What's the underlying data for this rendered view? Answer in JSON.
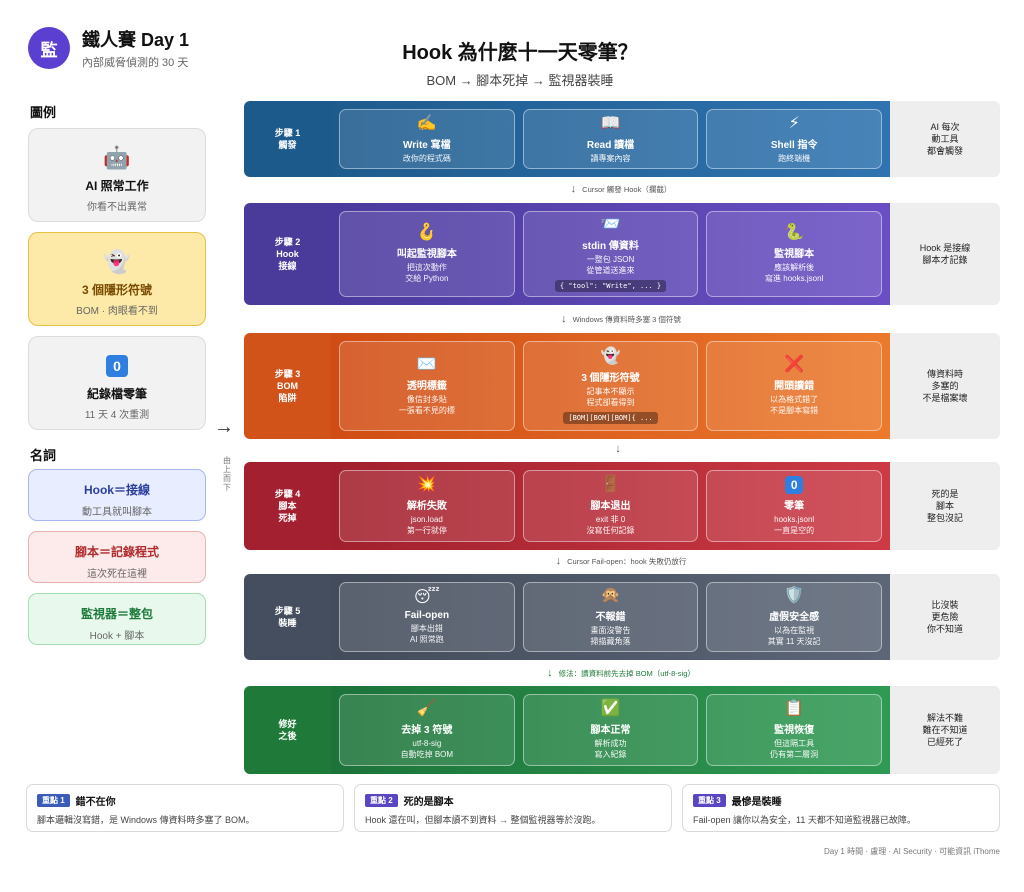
{
  "header": {
    "logo": "監",
    "title": "鐵人賽 Day 1",
    "subtitle": "內部威脅偵測的 30 天"
  },
  "main": {
    "title": "Hook 為什麼十一天零筆？",
    "subtitle": "BOM → 腳本死掉 → 監視器裝睡"
  },
  "legend": {
    "heading": "圖例",
    "items": [
      {
        "icon": "🤖",
        "title": "AI 照常工作",
        "sub": "你看不出異常",
        "bg": "#f2f2f2",
        "border": "#dcdcdc",
        "tc": "#111"
      },
      {
        "icon": "👻",
        "title": "3 個隱形符號",
        "sub": "BOM · 肉眼看不到",
        "bg": "#fde9a8",
        "border": "#e6bf45",
        "tc": "#7a4a00"
      },
      {
        "icon": "0",
        "title": "紀錄檔零筆",
        "sub": "11 天 4 次重測",
        "bg": "#f2f2f2",
        "border": "#dcdcdc",
        "tc": "#111"
      }
    ]
  },
  "terms": {
    "heading": "名詞",
    "items": [
      {
        "title": "Hook＝接線",
        "sub": "動工具就叫腳本",
        "bg": "#e8edff",
        "border": "#a9b7ee",
        "tc": "#2a3f9e"
      },
      {
        "title": "腳本＝記錄程式",
        "sub": "這次死在這裡",
        "bg": "#fdeaea",
        "border": "#ebb0b0",
        "tc": "#b02a2a"
      },
      {
        "title": "監視器＝整包",
        "sub": "Hook + 腳本",
        "bg": "#e8f8ec",
        "border": "#a5dcb3",
        "tc": "#1d7a3a"
      }
    ]
  },
  "flow_arrow": "→",
  "vertical_note": "由上而下",
  "rows": [
    {
      "step": "步驟 1\n觸發",
      "color": "#1d5a8c",
      "grad": "linear-gradient(90deg,#1e5b8d,#2f73b0)",
      "side": "AI 每次\n動工具\n都會觸發",
      "cards": [
        {
          "icon": "✍️",
          "title": "Write 寫檔",
          "sub": "改你的程式碼"
        },
        {
          "icon": "📖",
          "title": "Read 讀檔",
          "sub": "讀專案內容"
        },
        {
          "icon": "⚡",
          "title": "Shell 指令",
          "sub": "跑終端機"
        }
      ]
    },
    {
      "step": "步驟 2\nHook\n接線",
      "color": "#4a3a9a",
      "grad": "linear-gradient(90deg,#4b3a9d,#6a4fc4)",
      "side": "Hook 是接線\n腳本才記錄",
      "cards": [
        {
          "icon": "🪝",
          "title": "叫起監視腳本",
          "sub": "把這次動作\n交給 Python"
        },
        {
          "icon": "📨",
          "title": "stdin 傳資料",
          "sub": "一整包 JSON\n從管道送進來",
          "code": "{ \"tool\": \"Write\", ... }"
        },
        {
          "icon": "🐍",
          "title": "監視腳本",
          "sub": "應該解析後\n寫進 hooks.jsonl"
        }
      ]
    },
    {
      "step": "步驟 3\nBOM\n陷阱",
      "color": "#d2531a",
      "grad": "linear-gradient(90deg,#d04c14,#ec7a2c)",
      "side": "傳資料時\n多塞的\n不是檔案壞",
      "cards": [
        {
          "icon": "✉️",
          "title": "透明標籤",
          "sub": "像信封多貼\n一張看不見的標"
        },
        {
          "icon": "👻",
          "title": "3 個隱形符號",
          "sub": "記事本不顯示\n程式卻看得到",
          "code": "[BOM][BOM][BOM]{ ..."
        },
        {
          "icon": "❌",
          "title": "開頭讀錯",
          "sub": "以為格式錯了\n不是腳本寫錯"
        }
      ]
    },
    {
      "step": "步驟 4\n腳本\n死掉",
      "color": "#a32030",
      "grad": "linear-gradient(90deg,#a1202d,#cc3a45)",
      "side": "死的是\n腳本\n整包沒記",
      "cards": [
        {
          "icon": "💥",
          "title": "解析失敗",
          "sub": "json.load\n第一行就停"
        },
        {
          "icon": "🚪",
          "title": "腳本退出",
          "sub": "exit 非 0\n沒寫任何記錄"
        },
        {
          "icon": "0",
          "title": "零筆",
          "sub": "hooks.jsonl\n一直是空的"
        }
      ]
    },
    {
      "step": "步驟 5\n裝睡",
      "color": "#444e5e",
      "grad": "linear-gradient(90deg,#434c5b,#5c6677)",
      "side": "比沒裝\n更危險\n你不知道",
      "cards": [
        {
          "icon": "😴",
          "title": "Fail-open",
          "sub": "腳本出錯\nAI 照常跑"
        },
        {
          "icon": "🙊",
          "title": "不報錯",
          "sub": "畫面沒警告\n掃描藏角落"
        },
        {
          "icon": "🛡️",
          "title": "虛假安全感",
          "sub": "以為在監視\n其實 11 天沒記"
        }
      ]
    },
    {
      "step": "修好\n之後",
      "color": "#1f7a3a",
      "grad": "linear-gradient(90deg,#1d733a,#2f9a53)",
      "side": "解法不難\n難在不知道\n已經死了",
      "cards": [
        {
          "icon": "🧹",
          "title": "去掉 3 符號",
          "sub": "utf-8-sig\n自動吃掉 BOM"
        },
        {
          "icon": "✅",
          "title": "腳本正常",
          "sub": "解析成功\n寫入紀錄"
        },
        {
          "icon": "📋",
          "title": "監視恢復",
          "sub": "但這隔工具\n仍有第二層洞"
        }
      ]
    }
  ],
  "connectors": [
    "Cursor 觸發 Hook（攔截）",
    "Windows 傳資料時多塞 3 個符號",
    "",
    "Cursor Fail-open：hook 失敗仍放行",
    "修法：讀資料前先去掉 BOM（utf-8-sig）"
  ],
  "notes": [
    {
      "badge": "重點 1",
      "title": "錯不在你",
      "body": "腳本邏輯沒寫錯，是 Windows 傳資料時多塞了 BOM。"
    },
    {
      "badge": "重點 2",
      "title": "死的是腳本",
      "body": "Hook 還在叫，但腳本讀不到資料 → 整個監視器等於沒跑。"
    },
    {
      "badge": "重點 3",
      "title": "最慘是裝睡",
      "body": "Fail-open 讓你以為安全，11 天都不知道監視器已故障。"
    }
  ],
  "footer": "Day 1 時間 · 盧理 · AI Security · 可能資訊 iThome"
}
